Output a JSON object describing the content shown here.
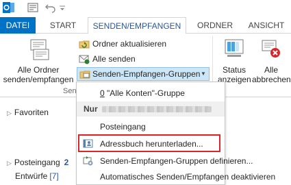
{
  "tabs": [
    "DATEI",
    "START",
    "SENDEN/EMPFANGEN",
    "ORDNER",
    "ANSICHT"
  ],
  "ribbon": {
    "send_all_folders": {
      "line1": "Alle Ordner",
      "line2": "senden/empfangen"
    },
    "update_folder": "Ordner aktualisieren",
    "send_all": "Alle senden",
    "sendreceive_groups": "Senden-Empfangen-Gruppen",
    "group_label": "Send",
    "status": {
      "line1": "Status",
      "line2": "anzeigen"
    },
    "cancel_all": {
      "line1": "Alle",
      "line2": "abbrechen"
    }
  },
  "folder_pane": {
    "favorites": "Favoriten",
    "inbox": "Posteingang",
    "inbox_count": "2",
    "drafts": "Entwürfe",
    "drafts_count": "[7]"
  },
  "menu": {
    "all_accounts_prefix": "0",
    "all_accounts_label": "\"Alle Konten\"-Gruppe",
    "only_header": "Nur",
    "inbox": "Posteingang",
    "download_address_book": "Adressbuch herunterladen...",
    "define_groups": "Senden-Empfangen-Gruppen definieren...",
    "disable_auto": "Automatisches Senden/Empfangen deaktivieren"
  },
  "colors": {
    "file_tab": "#0072c6",
    "accent_text": "#2b579a",
    "highlight": "#d9262c"
  }
}
